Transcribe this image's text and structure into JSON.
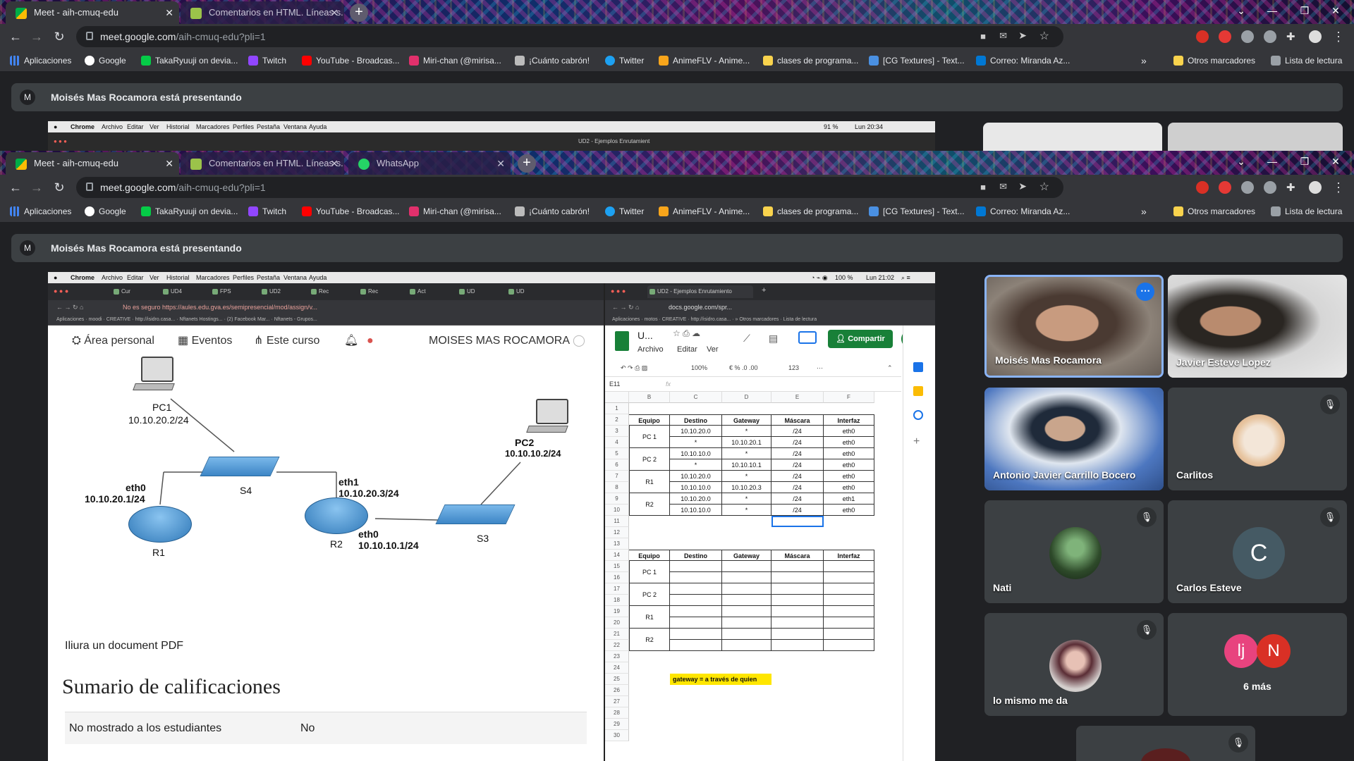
{
  "outer": {
    "tabs": [
      {
        "label": "Meet - aih-cmuq-edu"
      },
      {
        "label": "Comentarios en HTML. Líneas s..."
      }
    ],
    "url_host": "meet.google.com",
    "url_path": "/aih-cmuq-edu?pli=1",
    "presenting": "Moisés Mas Rocamora está presentando"
  },
  "inner": {
    "tabs": [
      {
        "label": "Meet - aih-cmuq-edu"
      },
      {
        "label": "Comentarios en HTML. Líneas s..."
      },
      {
        "label": "WhatsApp"
      }
    ],
    "url_host": "meet.google.com",
    "url_path": "/aih-cmuq-edu?pli=1",
    "presenting": "Moisés Mas Rocamora está presentando"
  },
  "bookmarks": [
    "Aplicaciones",
    "Google",
    "TakaRyuuji on devia...",
    "Twitch",
    "YouTube - Broadcas...",
    "Miri-chan (@mirisa...",
    "¡Cuánto cabrón!",
    "Twitter",
    "AnimeFLV - Anime...",
    "clases de programa...",
    "[CG Textures] - Text...",
    "Correo: Miranda Az..."
  ],
  "bookmarks_right": {
    "others": "Otros marcadores",
    "reading": "Lista de lectura"
  },
  "avatar_letter": "M",
  "mac": {
    "app": "Chrome",
    "menus": [
      "Archivo",
      "Editar",
      "Ver",
      "Historial",
      "Marcadores",
      "Perfiles",
      "Pestaña",
      "Ventana",
      "Ayuda"
    ],
    "status_top": "91 %",
    "clock_top": "Lun 20:34",
    "status": "100 %",
    "clock": "Lun 21:02",
    "top_tab_right": "UD2 - Ejemplos Enrutamient"
  },
  "moodle": {
    "address": "No es seguro  https://aules.edu.gva.es/semipresencial/mod/assign/v...",
    "nav": {
      "area": "Área personal",
      "eventos": "Eventos",
      "curso": "Este curso",
      "user": "MOISES MAS ROCAMORA"
    },
    "diagram": {
      "pc1": "PC1",
      "pc1_ip": "10.10.20.2/24",
      "pc2": "PC2",
      "pc2_ip": "10.10.10.2/24",
      "s4": "S4",
      "s3": "S3",
      "r1": "R1",
      "r2": "R2",
      "r1_if": "eth0",
      "r1_ip": "10.10.20.1/24",
      "r2_if1": "eth1",
      "r2_ip1": "10.10.20.3/24",
      "r2_if0": "eth0",
      "r2_ip0": "10.10.10.1/24"
    },
    "pdf": "Iliura un document PDF",
    "sumario": "Sumario de calificaciones",
    "rows": [
      {
        "k": "No mostrado a los estudiantes",
        "v": "No"
      }
    ]
  },
  "sheets": {
    "tab": "UD2 - Ejemplos Enrutamiento",
    "address": "docs.google.com/spr...",
    "title": "U...",
    "menus": [
      "Archivo",
      "Editar",
      "Ver"
    ],
    "share": "Compartir",
    "zoom": "100%",
    "format": "123",
    "cellref": "E11",
    "fx": "fx",
    "cols": [
      "B",
      "C",
      "D",
      "E",
      "F"
    ],
    "headers": [
      "Equipo",
      "Destino",
      "Gateway",
      "Máscara",
      "Interfaz"
    ],
    "table1": [
      [
        "10.10.20.0",
        "*",
        "/24",
        "eth0"
      ],
      [
        "*",
        "10.10.20.1",
        "/24",
        "eth0"
      ],
      [
        "10.10.10.0",
        "*",
        "/24",
        "eth0"
      ],
      [
        "*",
        "10.10.10.1",
        "/24",
        "eth0"
      ],
      [
        "10.10.20.0",
        "*",
        "/24",
        "eth0"
      ],
      [
        "10.10.10.0",
        "10.10.20.3",
        "/24",
        "eth0"
      ],
      [
        "10.10.20.0",
        "*",
        "/24",
        "eth1"
      ],
      [
        "10.10.10.0",
        "*",
        "/24",
        "eth0"
      ]
    ],
    "equipos": [
      "PC 1",
      "PC 2",
      "R1",
      "R2"
    ],
    "note": "gateway = a través de quien",
    "rownums": [
      "1",
      "2",
      "3",
      "4",
      "5",
      "6",
      "7",
      "8",
      "9",
      "10",
      "11",
      "12",
      "13",
      "14",
      "15",
      "16",
      "17",
      "18",
      "19",
      "20",
      "21",
      "22",
      "23",
      "24",
      "25",
      "26",
      "27",
      "28",
      "29",
      "30"
    ]
  },
  "participants": [
    {
      "name": "Moisés Mas Rocamora"
    },
    {
      "name": "Javier Esteve Lopez"
    },
    {
      "name": "Antonio Javier Carrillo Bocero"
    },
    {
      "name": "Carlitos"
    },
    {
      "name": "Nati"
    },
    {
      "name": "Carlos Esteve",
      "initial": "C"
    },
    {
      "name": "lo mismo me da"
    },
    {
      "label": "6 más",
      "initials": [
        "lj",
        "N"
      ]
    }
  ],
  "colors": {
    "accent": "#1a73e8",
    "sheets_green": "#188038",
    "note_yellow": "#ffe600"
  }
}
